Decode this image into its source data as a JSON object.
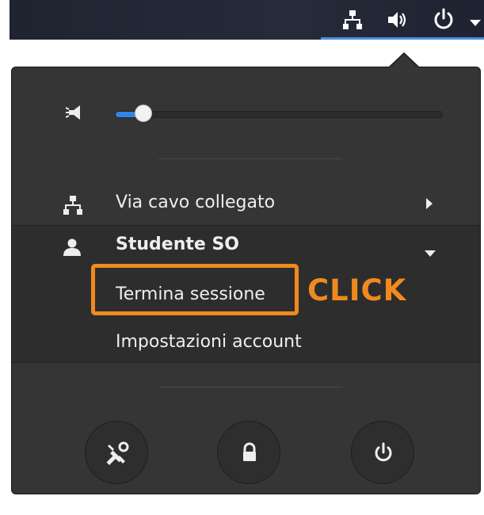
{
  "top_bar": {
    "icons": [
      "network-wired-icon",
      "volume-icon",
      "power-icon",
      "dropdown-arrow-icon"
    ],
    "accent_color": "#4a90d9"
  },
  "volume": {
    "icon": "speaker-muted-icon",
    "level_fraction": 0.06
  },
  "network": {
    "icon": "network-wired-icon",
    "label": "Via cavo collegato"
  },
  "user": {
    "icon": "user-icon",
    "name": "Studente SO",
    "items": [
      {
        "label": "Termina sessione"
      },
      {
        "label": "Impostazioni account"
      }
    ]
  },
  "annotation": {
    "text": "CLICK",
    "color": "#f08a1e"
  },
  "bottom_buttons": [
    {
      "icon": "settings-tools-icon"
    },
    {
      "icon": "lock-icon"
    },
    {
      "icon": "power-icon"
    }
  ]
}
